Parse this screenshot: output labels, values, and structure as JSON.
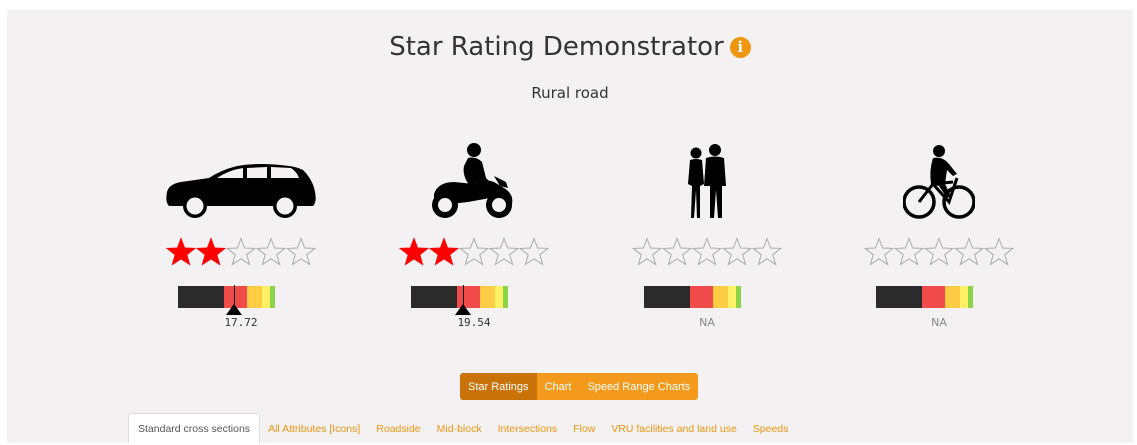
{
  "header": {
    "title": "Star Rating Demonstrator",
    "info_glyph": "i",
    "subtitle": "Rural road"
  },
  "colors": {
    "accent": "#f0960e",
    "star_filled": "#ff0000",
    "star_empty_stroke": "#aaaaaa",
    "scale": [
      "#2b2b2b",
      "#f04a4a",
      "#ffcc44",
      "#fff066",
      "#8bd44a"
    ]
  },
  "road_users": [
    {
      "icon": "car-icon",
      "stars_filled": 2,
      "stars_total": 5,
      "score": "17.72",
      "marker_fraction": 0.44
    },
    {
      "icon": "motorcycle-icon",
      "stars_filled": 2,
      "stars_total": 5,
      "score": "19.54",
      "marker_fraction": 0.41
    },
    {
      "icon": "pedestrian-icon",
      "stars_filled": 0,
      "stars_total": 5,
      "score": "NA"
    },
    {
      "icon": "bicycle-icon",
      "stars_filled": 0,
      "stars_total": 5,
      "score": "NA"
    }
  ],
  "view_buttons": [
    {
      "label": "Star Ratings",
      "active": true
    },
    {
      "label": "Chart",
      "active": false
    },
    {
      "label": "Speed Range Charts",
      "active": false
    }
  ],
  "tabs": [
    {
      "label": "Standard cross sections",
      "active": true
    },
    {
      "label": "All Attributes [Icons]",
      "active": false
    },
    {
      "label": "Roadside",
      "active": false
    },
    {
      "label": "Mid-block",
      "active": false
    },
    {
      "label": "Intersections",
      "active": false
    },
    {
      "label": "Flow",
      "active": false
    },
    {
      "label": "VRU facilities and land use",
      "active": false
    },
    {
      "label": "Speeds",
      "active": false
    }
  ]
}
